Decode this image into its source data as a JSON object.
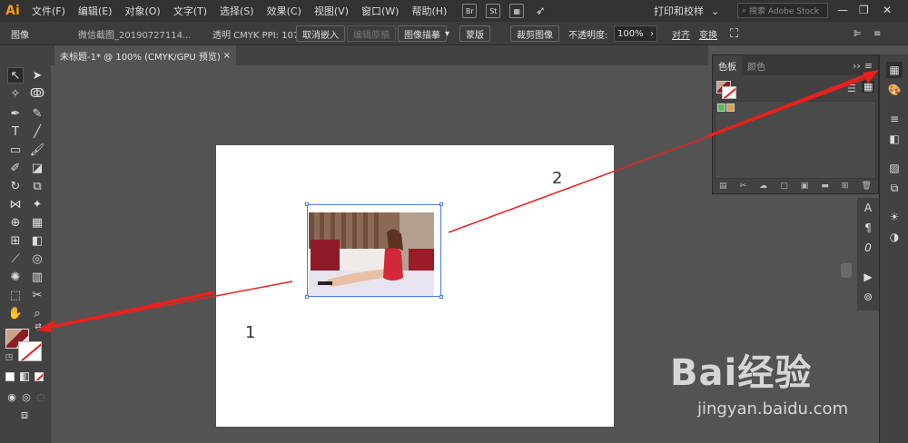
{
  "app": {
    "logo": "Ai"
  },
  "menu": [
    "文件(F)",
    "编辑(E)",
    "对象(O)",
    "文字(T)",
    "选择(S)",
    "效果(C)",
    "视图(V)",
    "窗口(W)",
    "帮助(H)"
  ],
  "menubar_buttons": {
    "br": "Br",
    "st": "St"
  },
  "workspace": "打印和校样",
  "stock_search": {
    "placeholder": "搜索 Adobe Stock"
  },
  "control_bar": {
    "object_type": "图像",
    "file_name": "微信截图_20190727114...",
    "color_info": "透明 CMYK PPI: 107x98",
    "embed_button": "取消嵌入",
    "edit_original": "编辑原稿",
    "trace_button": "图像描摹",
    "mask_button": "蒙版",
    "crop_button": "裁剪图像",
    "opacity_label": "不透明度:",
    "opacity_value": "100%",
    "align_label": "对齐",
    "transform_label": "变换"
  },
  "document_tab": {
    "title": "未标题-1* @ 100% (CMYK/GPU 预览)",
    "close": "×"
  },
  "swatches_panel": {
    "tabs": [
      "色板",
      "颜色"
    ],
    "menu_glyph": "≡"
  },
  "annotations": {
    "label_1": "1",
    "label_2": "2"
  },
  "watermark": {
    "brand": "Bai经验",
    "url": "jingyan.baidu.com"
  },
  "colors": {
    "arrow": "#e8201c",
    "selection": "#4b7bec",
    "accent": "#ff9a00"
  }
}
